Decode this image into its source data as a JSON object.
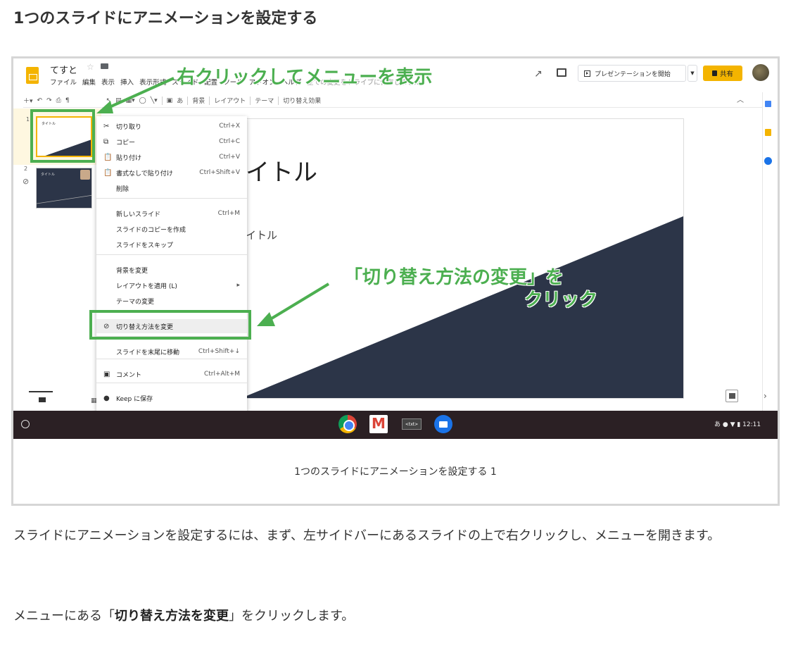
{
  "article": {
    "heading": "1つのスライドにアニメーションを設定する",
    "paragraph1": "スライドにアニメーションを設定するには、まず、左サイドバーにあるスライドの上で右クリックし、メニューを開きます。",
    "paragraph2_before": "メニューにある「",
    "paragraph2_bold": "切り替え方法を変更",
    "paragraph2_after": "」をクリックします。"
  },
  "figure": {
    "caption": "1つのスライドにアニメーションを設定する 1"
  },
  "slides_app": {
    "doc_title": "てすと",
    "menu": [
      "ファイル",
      "編集",
      "表示",
      "挿入",
      "表示形式",
      "スライド",
      "配置",
      "ツール",
      "アドオン",
      "ヘルプ"
    ],
    "last_edit": "全ての変更をドライブに保存しました",
    "present_label": "プレゼンテーションを開始",
    "share_label": "共有",
    "toolbar": {
      "background": "背景",
      "layout": "レイアウト",
      "theme": "テーマ",
      "transition": "切り替え効果",
      "font_glyph": "あ"
    },
    "filmstrip": {
      "slide1_number": "1",
      "slide2_number": "2",
      "thumb_title": "タイトル"
    },
    "slide": {
      "title": "イトル",
      "subtitle": "イトル",
      "dark_color": "#2c3548"
    },
    "context_menu": [
      {
        "icon": "scissors-icon",
        "glyph": "✂",
        "label": "切り取り",
        "shortcut": "Ctrl+X"
      },
      {
        "icon": "copy-icon",
        "glyph": "⧉",
        "label": "コピー",
        "shortcut": "Ctrl+C"
      },
      {
        "icon": "paste-icon",
        "glyph": "📋",
        "label": "貼り付け",
        "shortcut": "Ctrl+V"
      },
      {
        "icon": "paste-plain-icon",
        "glyph": "📋",
        "label": "書式なしで貼り付け",
        "shortcut": "Ctrl+Shift+V"
      },
      {
        "icon": "",
        "glyph": "",
        "label": "削除",
        "shortcut": ""
      },
      {
        "icon": "",
        "glyph": "",
        "label": "新しいスライド",
        "shortcut": "Ctrl+M"
      },
      {
        "icon": "",
        "glyph": "",
        "label": "スライドのコピーを作成",
        "shortcut": ""
      },
      {
        "icon": "",
        "glyph": "",
        "label": "スライドをスキップ",
        "shortcut": ""
      },
      {
        "icon": "",
        "glyph": "",
        "label": "背景を変更",
        "shortcut": ""
      },
      {
        "icon": "",
        "glyph": "",
        "label": "レイアウトを適用 (L)",
        "shortcut": "▸"
      },
      {
        "icon": "",
        "glyph": "",
        "label": "テーマの変更",
        "shortcut": ""
      },
      {
        "icon": "transition-icon",
        "glyph": "⊘",
        "label": "切り替え方法を変更",
        "shortcut": ""
      },
      {
        "icon": "",
        "glyph": "",
        "label": "スライドを末尾に移動",
        "shortcut": "Ctrl+Shift+↓"
      },
      {
        "icon": "comment-icon",
        "glyph": "▣",
        "label": "コメント",
        "shortcut": "Ctrl+Alt+M"
      },
      {
        "icon": "keep-icon",
        "glyph": "●",
        "label": "Keep に保存",
        "shortcut": ""
      }
    ]
  },
  "annotations": {
    "top": "右クリックしてメニューを表示",
    "mid_line1": "「切り替え方法の変更」を",
    "mid_line2": "クリック",
    "color": "#4caf50"
  },
  "taskbar": {
    "txt_app_label": "<txt>",
    "tray": "あ ● ▼ ▮ 12:11",
    "background": "#2b2024"
  }
}
